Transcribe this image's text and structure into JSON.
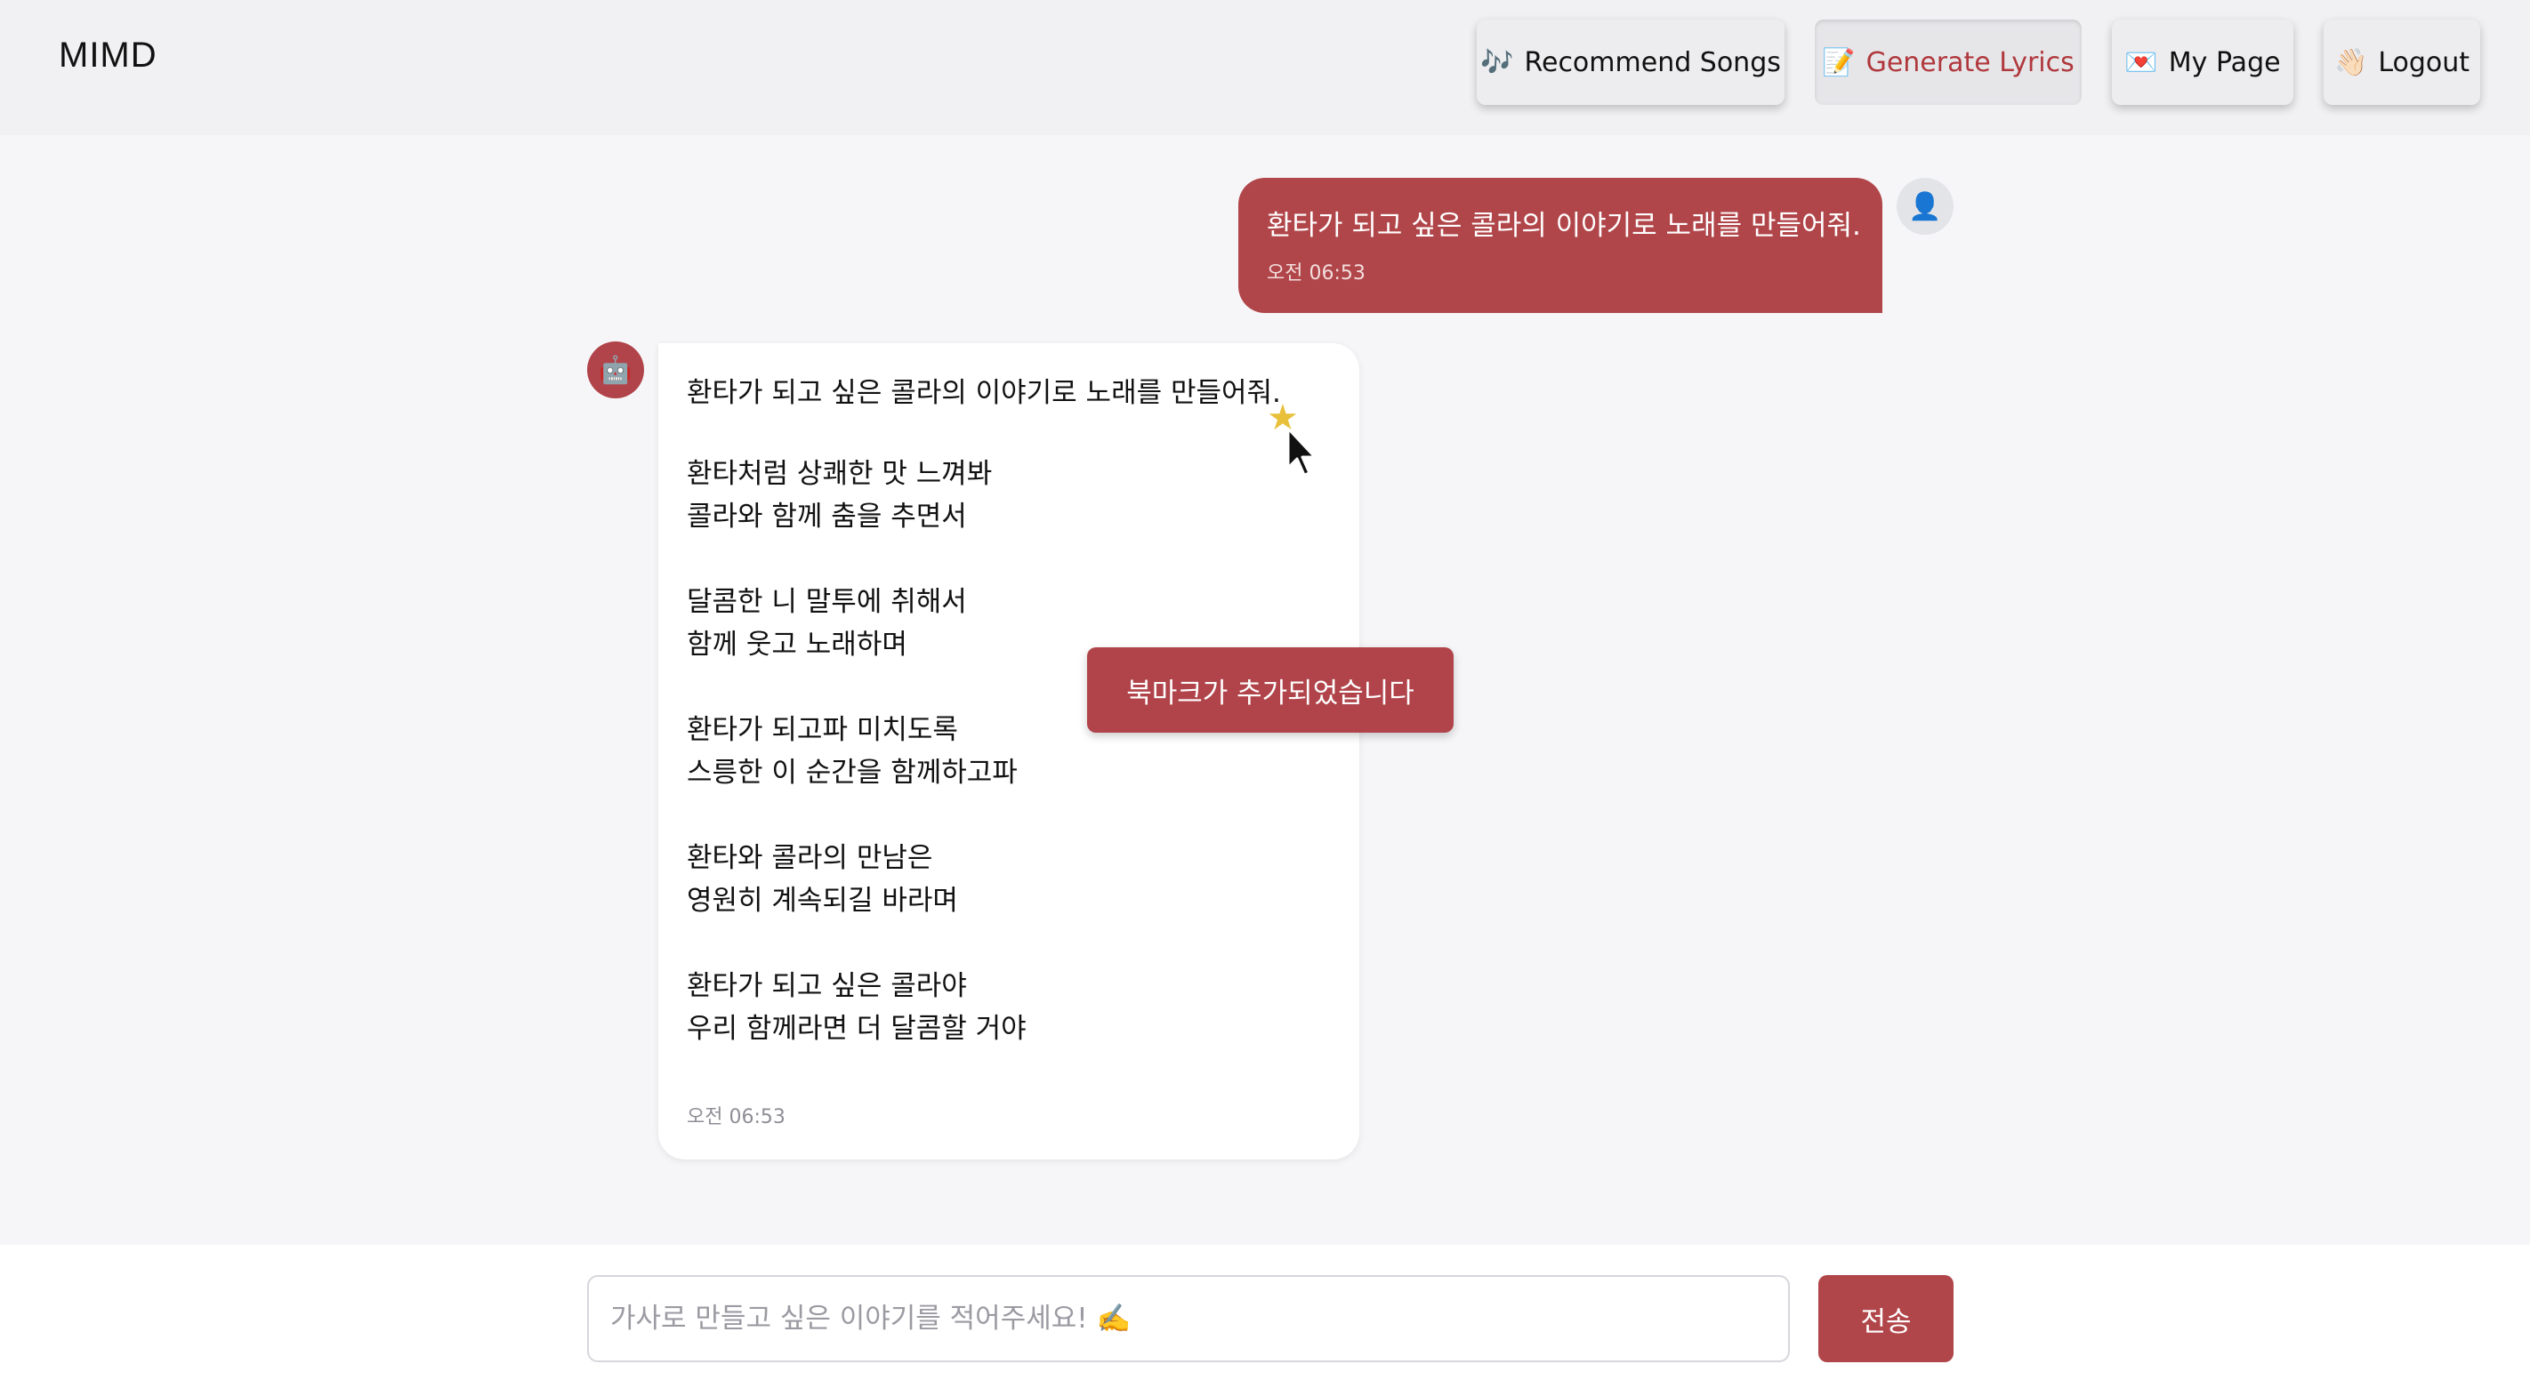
{
  "app": {
    "logo": "MIMD"
  },
  "nav": {
    "recommend": {
      "icon": "🎶",
      "label": "Recommend Songs"
    },
    "lyrics": {
      "icon": "📝",
      "label": "Generate Lyrics"
    },
    "mypage": {
      "icon": "💌",
      "label": "My Page"
    },
    "logout": {
      "icon": "👋🏻",
      "label": "Logout"
    }
  },
  "chat": {
    "user_message": {
      "avatar_icon": "👤",
      "text": "환타가 되고 싶은 콜라의 이야기로 노래를 만들어줘.",
      "time": "오전 06:53"
    },
    "bot_message": {
      "avatar_icon": "🤖",
      "title": "환타가 되고 싶은 콜라의 이야기로 노래를 만들어줘.",
      "stanzas": [
        [
          "환타처럼 상쾌한 맛 느껴봐",
          "콜라와 함께 춤을 추면서"
        ],
        [
          "달콤한 니 말투에 취해서",
          "함께 웃고 노래하며"
        ],
        [
          "환타가 되고파 미치도록",
          "스릉한 이 순간을 함께하고파"
        ],
        [
          "환타와 콜라의 만남은",
          "영원히 계속되길 바라며"
        ],
        [
          "환타가 되고 싶은 콜라야",
          "우리 함께라면 더 달콤할 거야"
        ]
      ],
      "time": "오전 06:53",
      "bookmark_icon": "★"
    },
    "toast": "북마크가 추가되었습니다"
  },
  "input": {
    "placeholder": "가사로 만들고 싶은 이야기를 적어주세요! ✍️",
    "value": "",
    "send_label": "전송"
  },
  "colors": {
    "accent": "#b1464a",
    "header_bg": "#f1f1f3",
    "page_bg": "#f6f6f8",
    "star": "#e8c03a"
  }
}
